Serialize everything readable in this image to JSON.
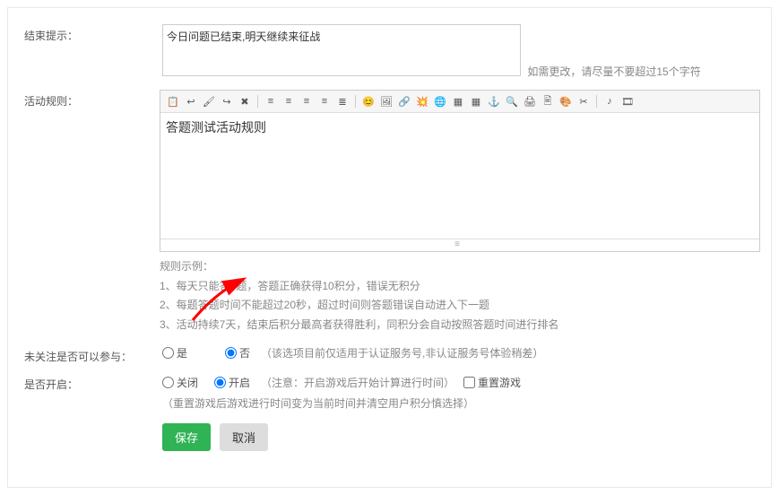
{
  "endHint": {
    "label": "结束提示：",
    "value": "今日问题已结束,明天继续来征战",
    "hint": "如需更改，请尽量不要超过15个字符"
  },
  "rules": {
    "label": "活动规则：",
    "editorContent": "答题测试活动规则",
    "exampleTitle": "规则示例：",
    "examples": [
      "1、每天只能答5题，答题正确获得10积分，错误无积分",
      "2、每题答题时间不能超过20秒，超过时间则答题错误自动进入下一题",
      "3、活动持续7天，结束后积分最高者获得胜利，同积分会自动按照答题时间进行排名"
    ]
  },
  "participate": {
    "label": "未关注是否可以参与：",
    "yes": "是",
    "no": "否",
    "note": "（该选项目前仅适用于认证服务号,非认证服务号体验稍差）"
  },
  "enable": {
    "label": "是否开启：",
    "close": "关闭",
    "open": "开启",
    "openNote": "（注意：开启游戏后开始计算进行时间）",
    "resetLabel": "重置游戏",
    "resetNote": "（重置游戏后游戏进行时间变为当前时间并清空用户积分慎选择）"
  },
  "buttons": {
    "save": "保存",
    "cancel": "取消"
  },
  "toolbarIcons": [
    "📋",
    "↩",
    "🖌",
    "↪",
    "✖",
    "|",
    "≡",
    "≡",
    "≡",
    "≡",
    "≣",
    "|",
    "😊",
    "🖼",
    "🔗",
    "💥",
    "🌐",
    "▦",
    "▦",
    "⚓",
    "🔍",
    "🖨",
    "🖹",
    "🎨",
    "✂",
    "|",
    "♪",
    "🎞"
  ]
}
